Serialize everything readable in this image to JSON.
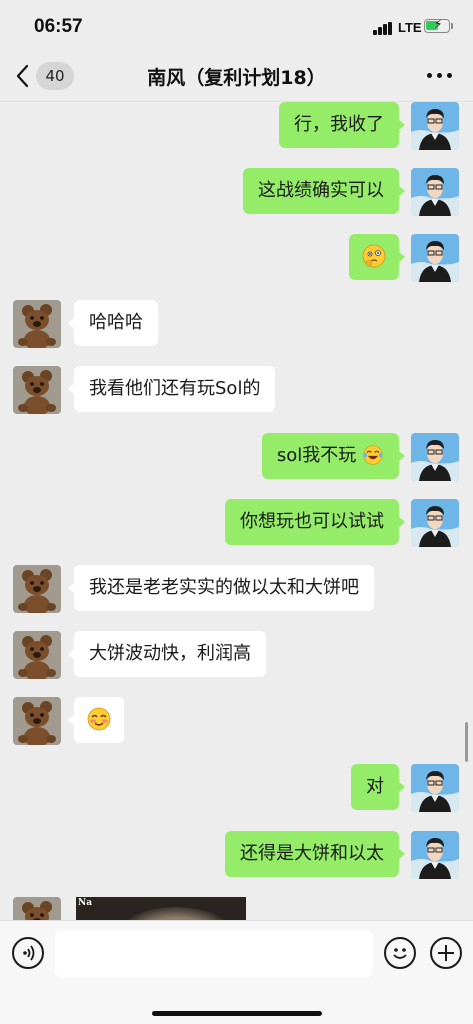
{
  "status_bar": {
    "time": "06:57",
    "network": "LTE"
  },
  "header": {
    "back_count": "40",
    "title": "南风（复利计划18）"
  },
  "messages": [
    {
      "side": "me",
      "text": "行，我收了"
    },
    {
      "side": "me",
      "text": "这战绩确实可以"
    },
    {
      "side": "me",
      "text": "",
      "emoji": "thinking-face-emoji"
    },
    {
      "side": "other",
      "text": "哈哈哈"
    },
    {
      "side": "other",
      "text": "我看他们还有玩Sol的"
    },
    {
      "side": "me",
      "text": "sol我不玩",
      "emoji": "tears-of-joy-emoji"
    },
    {
      "side": "me",
      "text": "你想玩也可以试试"
    },
    {
      "side": "other",
      "text": "我还是老老实实的做以太和大饼吧"
    },
    {
      "side": "other",
      "text": "大饼波动快，利润高"
    },
    {
      "side": "other",
      "text": "",
      "emoji": "blushing-smile-emoji"
    },
    {
      "side": "me",
      "text": "对"
    },
    {
      "side": "me",
      "text": "还得是大饼和以太"
    },
    {
      "side": "other",
      "type": "image",
      "image_tag": "Na"
    }
  ],
  "colors": {
    "self_bubble": "#95ec69",
    "other_bubble": "#ffffff",
    "background": "#ededed"
  },
  "input": {
    "placeholder": ""
  }
}
